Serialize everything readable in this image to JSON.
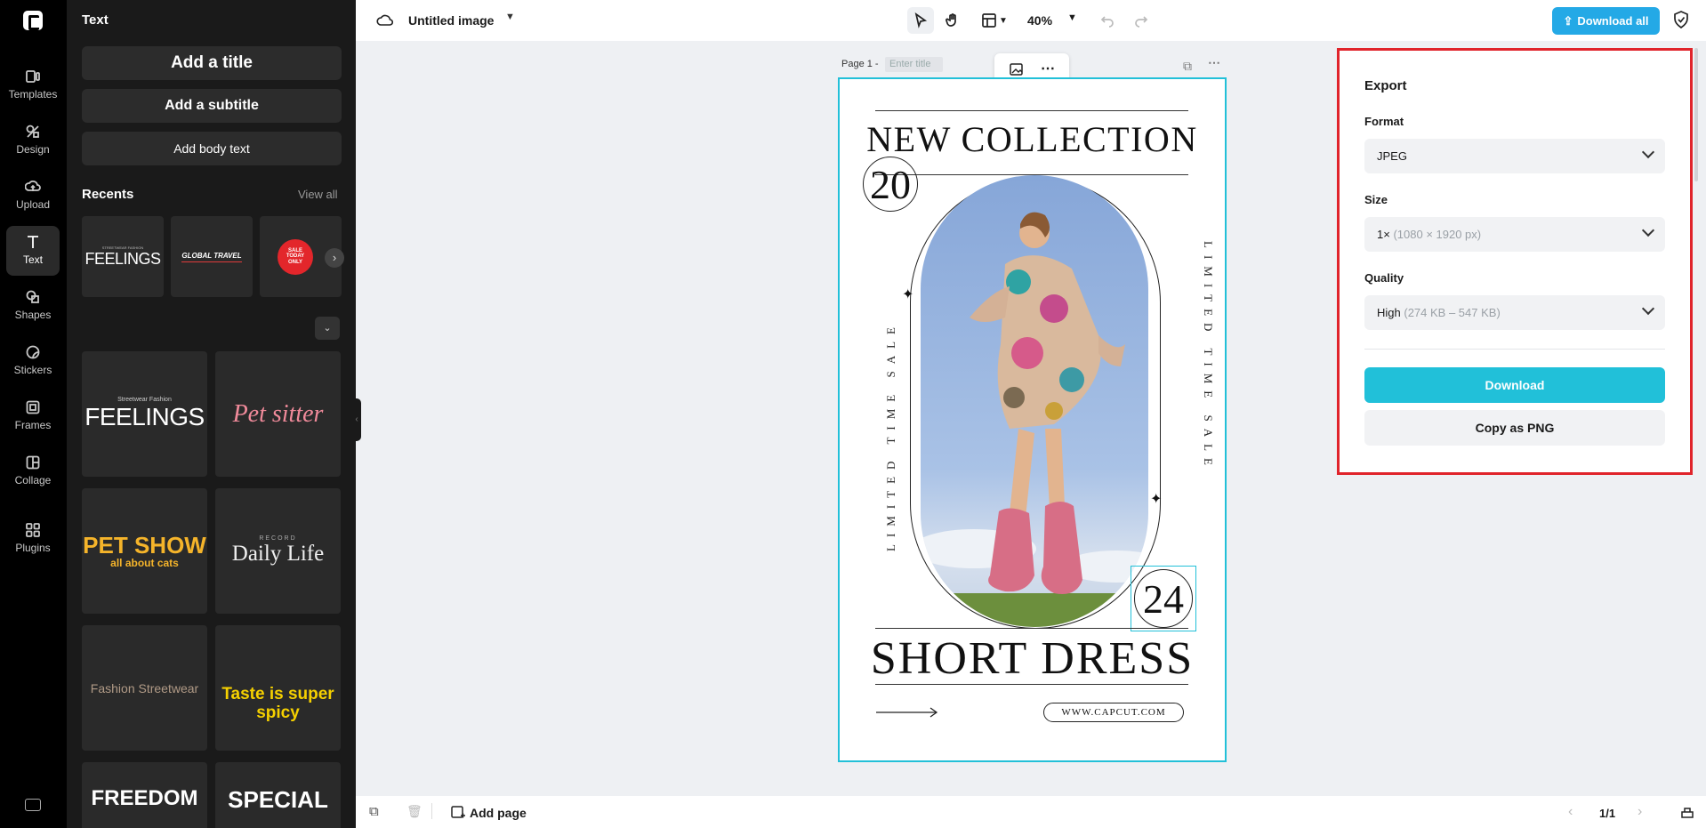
{
  "rail": {
    "items": [
      {
        "label": "Templates",
        "icon": "templates-icon"
      },
      {
        "label": "Design",
        "icon": "design-icon"
      },
      {
        "label": "Upload",
        "icon": "upload-icon"
      },
      {
        "label": "Text",
        "icon": "text-icon",
        "active": true
      },
      {
        "label": "Shapes",
        "icon": "shapes-icon"
      },
      {
        "label": "Stickers",
        "icon": "stickers-icon"
      },
      {
        "label": "Frames",
        "icon": "frames-icon"
      },
      {
        "label": "Collage",
        "icon": "collage-icon"
      },
      {
        "label": "Plugins",
        "icon": "plugins-icon"
      }
    ]
  },
  "panel": {
    "title": "Text",
    "add_title": "Add a title",
    "add_subtitle": "Add a subtitle",
    "add_body": "Add body text",
    "recents_label": "Recents",
    "view_all": "View all",
    "recents": [
      {
        "line1": "STREETWEAR FASHION",
        "line2": "FEELINGS"
      },
      {
        "line1": "GLOBAL TRAVEL"
      },
      {
        "line1": "SALE",
        "line2": "TODAY",
        "line3": "ONLY"
      }
    ],
    "templates": [
      {
        "line1": "Streetwear Fashion",
        "line2": "FEELINGS"
      },
      {
        "line1": "Pet sitter"
      },
      {
        "line1": "PET SHOW",
        "line2": "all about cats"
      },
      {
        "line1": "RECORD",
        "line2": "Daily Life"
      },
      {
        "line1": "Fashion Streetwear"
      },
      {
        "line1": "Taste is super spicy"
      },
      {
        "line1": "FREEDOM"
      },
      {
        "line1": "SPECIAL"
      }
    ]
  },
  "topbar": {
    "doc_title": "Untitled image",
    "zoom": "40%",
    "download_all": "Download all"
  },
  "canvas": {
    "page_label": "Page 1 -",
    "title_placeholder": "Enter title",
    "poster": {
      "headline": "NEW COLLECTION",
      "num_top": "20",
      "num_bottom": "24",
      "side_left": "LIMITED TIME SALE",
      "side_right": "LIMITED TIME SALE",
      "subhead": "SHORT DRESS",
      "url": "WWW.CAPCUT.COM"
    }
  },
  "bottombar": {
    "add_page": "Add page",
    "pager": "1/1"
  },
  "export": {
    "title": "Export",
    "format_label": "Format",
    "format_value": "JPEG",
    "size_label": "Size",
    "size_value": "1×",
    "size_detail": "(1080 × 1920 px)",
    "quality_label": "Quality",
    "quality_value": "High",
    "quality_detail": "(274 KB – 547 KB)",
    "download": "Download",
    "copy_png": "Copy as PNG"
  },
  "colors": {
    "accent": "#21c0d9",
    "download_all_bg": "#24a9e6",
    "highlight_border": "#e0242b",
    "panel_bg": "#1a1a1a",
    "rail_bg": "#000000"
  }
}
